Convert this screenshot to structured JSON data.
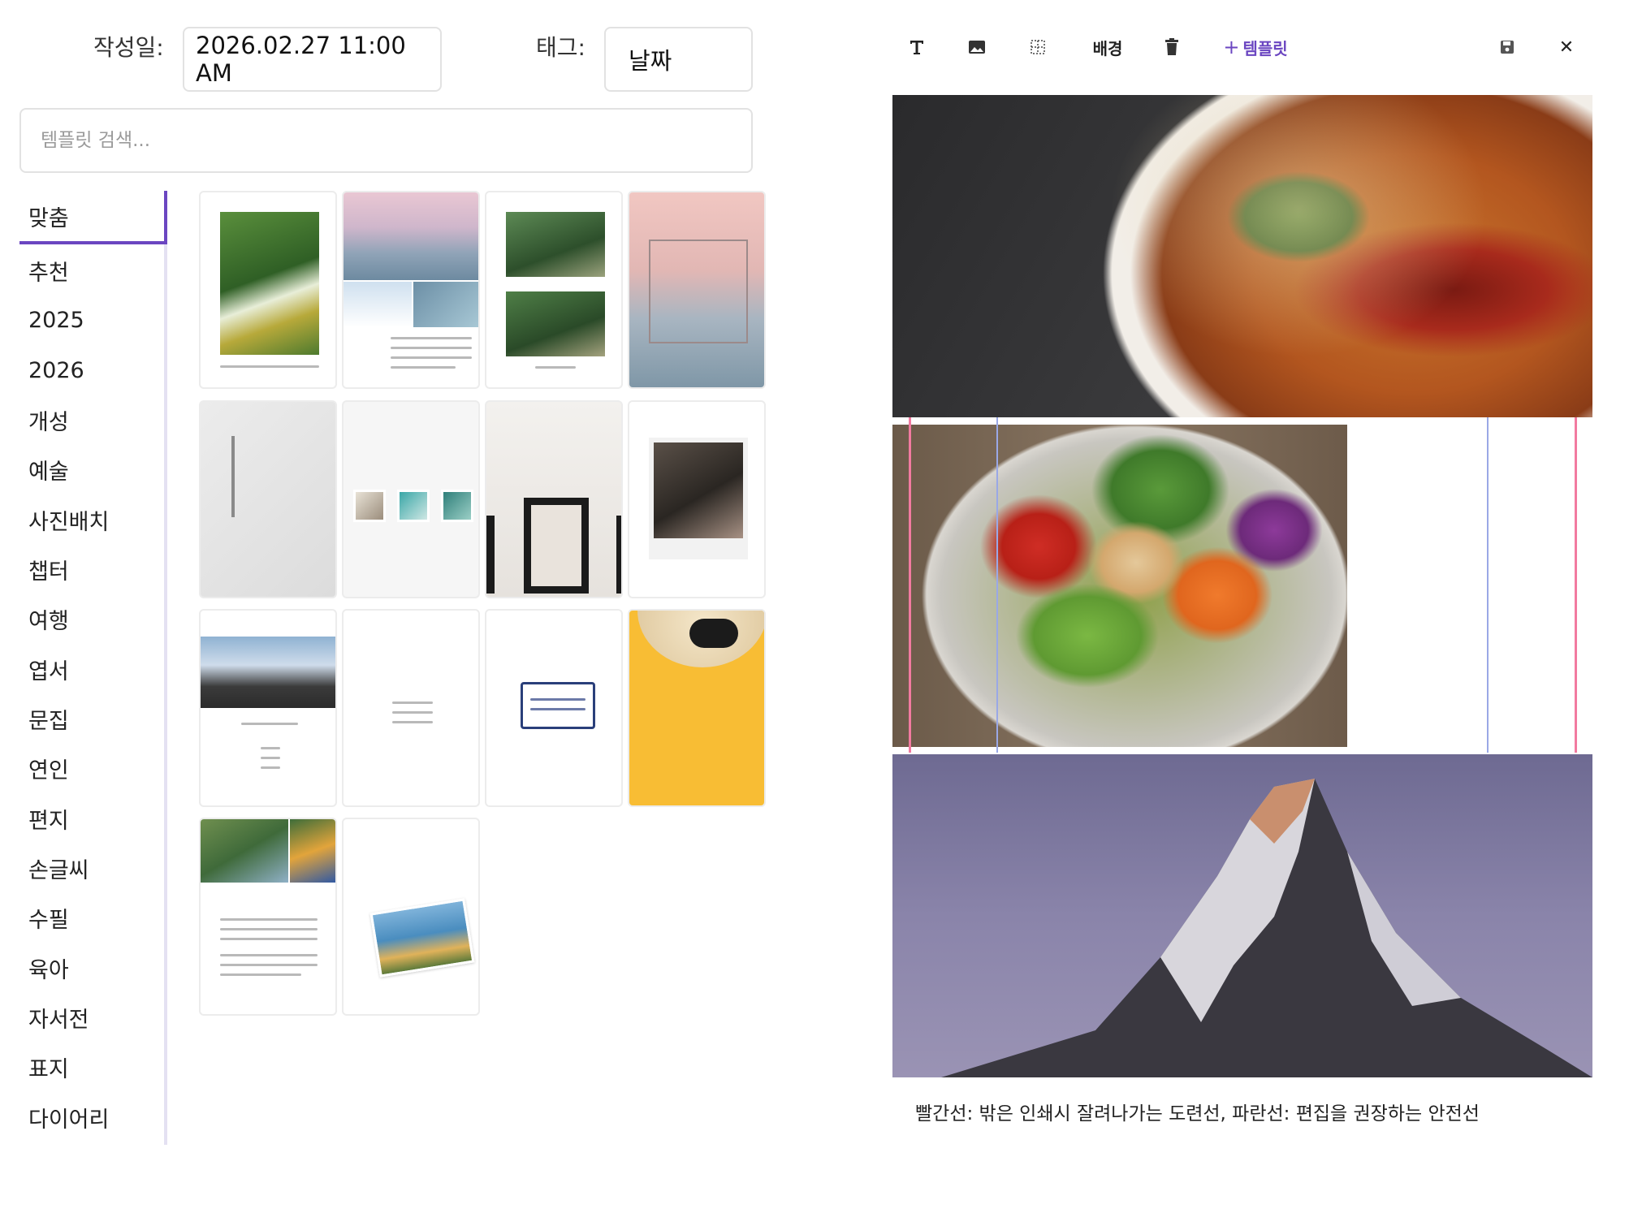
{
  "form": {
    "date_label": "작성일:",
    "date_value": "2026.02.27 11:00 AM",
    "tag_label": "태그:",
    "tag_value": "날짜",
    "search_placeholder": "템플릿 검색..."
  },
  "categories": [
    "맞춤",
    "추천",
    "2025",
    "2026",
    "개성",
    "예술",
    "사진배치",
    "챕터",
    "여행",
    "엽서",
    "문집",
    "연인",
    "편지",
    "손글씨",
    "수필",
    "육아",
    "자서전",
    "표지",
    "다이어리"
  ],
  "active_category": "맞춤",
  "templates": [
    {
      "name": "gardening-photo"
    },
    {
      "name": "sea-sunset-collage"
    },
    {
      "name": "couple-two-photos"
    },
    {
      "name": "social-post-frame"
    },
    {
      "name": "gray-vertical-text"
    },
    {
      "name": "hanging-polaroids"
    },
    {
      "name": "framed-photos-wall"
    },
    {
      "name": "polaroid-family"
    },
    {
      "name": "hanok-roof"
    },
    {
      "name": "minimal-quote"
    },
    {
      "name": "quote-box"
    },
    {
      "name": "yellow-hat-cover"
    },
    {
      "name": "parrot-collage"
    },
    {
      "name": "floral-tilted-photo"
    }
  ],
  "toolbar": {
    "background_label": "배경",
    "template_label": "템플릿",
    "template_plus": "+",
    "close_symbol": "✕",
    "accent_color": "#6b46c1"
  },
  "canvas_images": [
    "curry-bowl-photo",
    "salad-bowl-photo",
    "matterhorn-mountain-photo"
  ],
  "guide_colors": {
    "bleed": "#f27aa0",
    "safe": "#9aa8e6"
  },
  "hint_text": "빨간선: 밖은 인쇄시 잘려나가는 도련선, 파란선: 편집을 권장하는 안전선"
}
